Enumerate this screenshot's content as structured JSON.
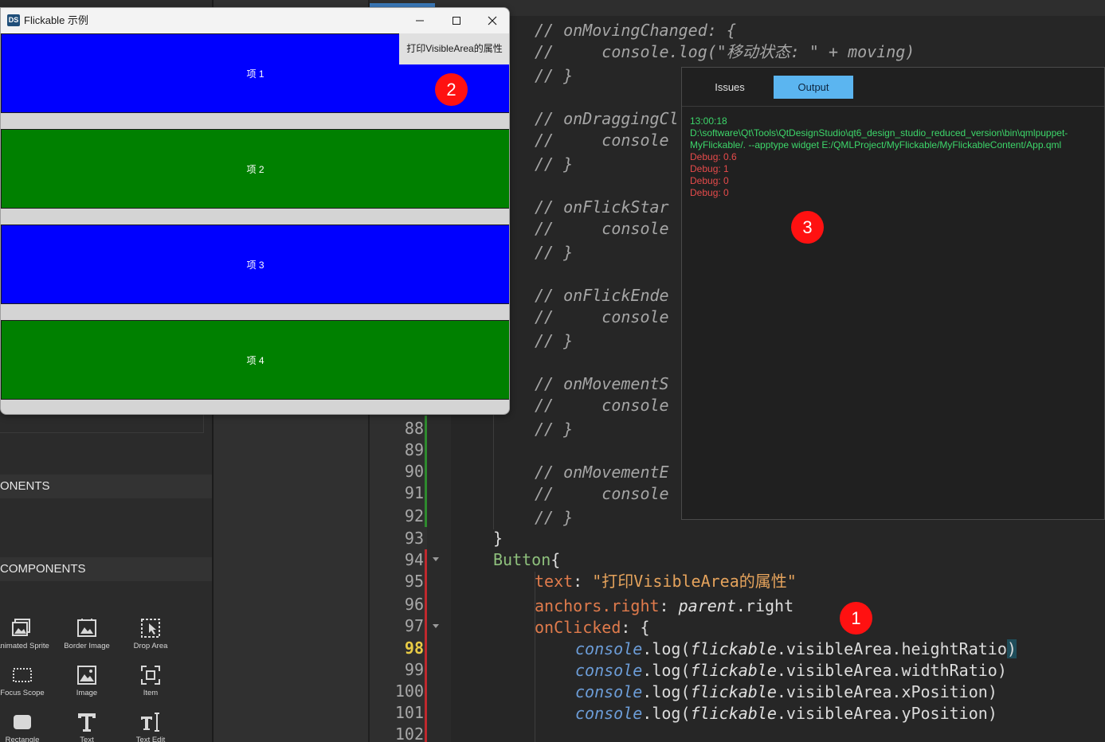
{
  "flickable_window": {
    "title": "Flickable 示例",
    "logo_text": "DS",
    "print_button": "打印VisibleArea的属性",
    "items": [
      {
        "label": "项 1",
        "color": "#0000ff"
      },
      {
        "label": "项 2",
        "color": "#008000"
      },
      {
        "label": "项 3",
        "color": "#0000ff"
      },
      {
        "label": "项 4",
        "color": "#008000"
      }
    ]
  },
  "library": {
    "sections": [
      "ONENTS",
      "COMPONENTS"
    ],
    "components": [
      {
        "label": "Animated Sprite",
        "icon": "animated-sprite-icon"
      },
      {
        "label": "Border Image",
        "icon": "border-image-icon"
      },
      {
        "label": "Drop Area",
        "icon": "drop-area-icon"
      },
      {
        "label": "Focus Scope",
        "icon": "focus-scope-icon"
      },
      {
        "label": "Image",
        "icon": "image-icon"
      },
      {
        "label": "Item",
        "icon": "item-icon"
      },
      {
        "label": "Rectangle",
        "icon": "rectangle-icon"
      },
      {
        "label": "Text",
        "icon": "text-icon"
      },
      {
        "label": "Text Edit",
        "icon": "text-edit-icon"
      }
    ]
  },
  "editor": {
    "line_numbers": [
      "88",
      "89",
      "90",
      "91",
      "92",
      "93",
      "94",
      "95",
      "96",
      "97",
      "98",
      "99",
      "100",
      "101",
      "102"
    ],
    "current_line": "98",
    "comment_blocks": [
      {
        "handler": "// onMovingChanged: {",
        "body": "//     console.log(\"移动状态: \" + moving)",
        "close": "// }"
      },
      {
        "handler": "// onDraggingCl",
        "body": "//     console",
        "close": "// }"
      },
      {
        "handler": "// onFlickStar",
        "body": "//     console",
        "close": "// }"
      },
      {
        "handler": "// onFlickEnde",
        "body": "//     console",
        "close": "// }"
      },
      {
        "handler": "// onMovementS",
        "body": "//     console",
        "close": "// }"
      },
      {
        "handler": "// onMovementE",
        "body": "//     console",
        "close": "// }"
      }
    ],
    "code": {
      "close_brace": "}",
      "button_type": "Button",
      "open_brace": "{",
      "text_prop": "text",
      "text_value": "\"打印VisibleArea的属性\"",
      "anchors_prop": "anchors.right",
      "parent_obj": "parent",
      "right_member": ".right",
      "onclicked_prop": "onClicked",
      "console_obj": "console",
      "log_call": ".log(",
      "flickable_obj": "flickable",
      "visible_area": ".visibleArea.",
      "props": [
        "heightRatio",
        "widthRatio",
        "xPosition",
        "yPosition"
      ],
      "close_paren": ")",
      "colon": ":"
    }
  },
  "output_pane": {
    "tabs": [
      {
        "label": "Issues",
        "active": false
      },
      {
        "label": "Output",
        "active": true
      }
    ],
    "lines": [
      {
        "text": "13:00:18",
        "kind": "info"
      },
      {
        "text": "D:\\software\\Qt\\Tools\\QtDesignStudio\\qt6_design_studio_reduced_version\\bin\\qmlpuppet-",
        "kind": "info"
      },
      {
        "text": "MyFlickable/. --apptype widget E:/QMLProject/MyFlickable/MyFlickableContent/App.qml",
        "kind": "info"
      },
      {
        "text": "Debug: 0.6",
        "kind": "debug"
      },
      {
        "text": "Debug: 1",
        "kind": "debug"
      },
      {
        "text": "Debug: 0",
        "kind": "debug"
      },
      {
        "text": "Debug: 0",
        "kind": "debug"
      }
    ]
  },
  "markers": [
    "1",
    "2",
    "3"
  ],
  "colors": {
    "output_info": "#3dd66a",
    "output_debug": "#e64b4b",
    "marker": "#ff1111",
    "active_tab": "#5bb5f0",
    "change_bar_green": "#2e8b2e",
    "change_bar_red": "#c0282d"
  }
}
